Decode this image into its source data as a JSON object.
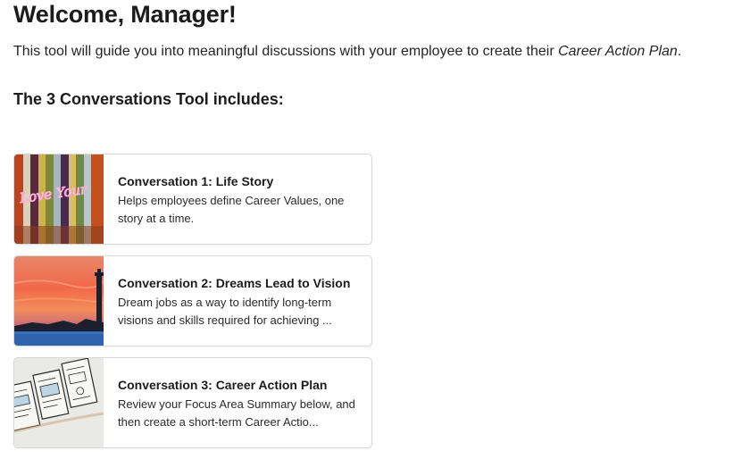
{
  "header": {
    "title": "Welcome, Manager!",
    "intro_text": "This tool will guide you into meaningful discussions with your employee to create their ",
    "intro_emphasis": "Career Action Plan",
    "intro_end": "."
  },
  "section": {
    "subtitle": "The 3 Conversations Tool includes:"
  },
  "cards": [
    {
      "title": "Conversation 1: Life Story",
      "description": "Helps employees define Career Values, one story at a time.",
      "image": "neon-love-your-stripes-image",
      "neon_text": "Love Your"
    },
    {
      "title": "Conversation 2: Dreams Lead to Vision",
      "description": "Dream jobs as a way to identify long-term visions and skills required for achieving ...",
      "image": "lighthouse-sunset-image"
    },
    {
      "title": "Conversation 3: Career Action Plan",
      "description": "Review your Focus Area Summary below, and then create a short-term Career Actio...",
      "image": "wireframe-sketch-image"
    }
  ],
  "colors": {
    "border": "#d9d9d9",
    "text": "#1c1c1c",
    "neon_pink": "#ff8fd1"
  }
}
